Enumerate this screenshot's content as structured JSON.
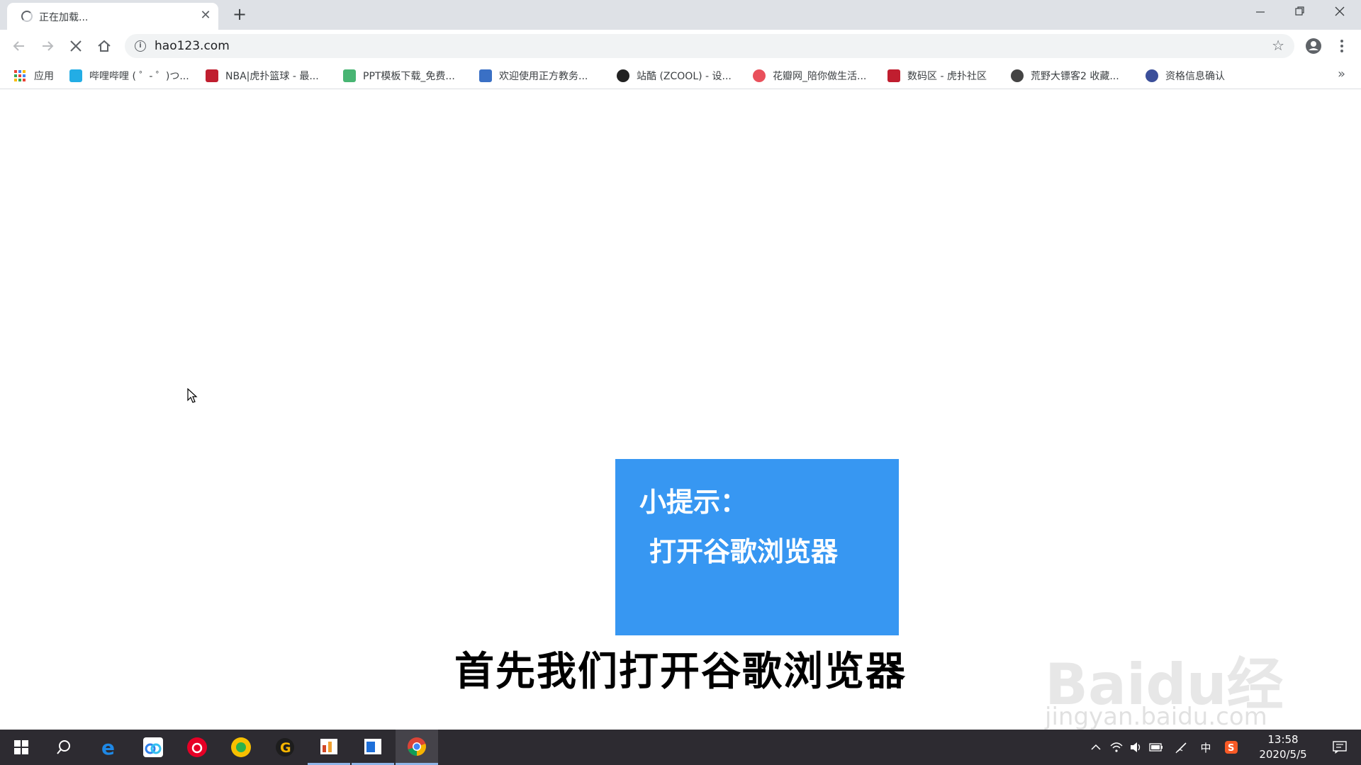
{
  "tab": {
    "title": "正在加载..."
  },
  "window_controls": {
    "minimize": "—",
    "restore": "❐",
    "close": "✕"
  },
  "toolbar": {
    "url": "hao123.com"
  },
  "bookmarks": [
    {
      "label": "应用",
      "icon": "apps-grid-icon"
    },
    {
      "label": "哔哩哔哩 ( ゜- ゜)つ...",
      "icon": "bilibili-icon",
      "color": "#23ade5"
    },
    {
      "label": "NBA|虎扑篮球 - 最...",
      "icon": "hupu-icon",
      "color": "#c01e2f"
    },
    {
      "label": "PPT模板下载_免费...",
      "icon": "ppt-template-icon",
      "color": "#48b573"
    },
    {
      "label": "欢迎使用正方教务...",
      "icon": "zhengfang-icon",
      "color": "#3a70c5"
    },
    {
      "label": "站酷 (ZCOOL) - 设...",
      "icon": "zcool-icon",
      "color": "#222222"
    },
    {
      "label": "花瓣网_陪你做生活...",
      "icon": "huaban-icon",
      "color": "#e9505b"
    },
    {
      "label": "数码区 - 虎扑社区",
      "icon": "hupu-icon",
      "color": "#c01e2f"
    },
    {
      "label": "荒野大镖客2 收藏...",
      "icon": "rdr2-icon",
      "color": "#444444"
    },
    {
      "label": "资格信息确认",
      "icon": "seal-icon",
      "color": "#3b4f9a"
    }
  ],
  "bookmarks_more": "»",
  "tip": {
    "title": "小提示：",
    "text": "打开谷歌浏览器"
  },
  "subtitle": "首先我们打开谷歌浏览器",
  "watermark": {
    "text": "Baidu经验",
    "sub": "jingyan.baidu.com"
  },
  "taskbar": {
    "apps": [
      "windows-start-icon",
      "search-icon",
      "edge-icon",
      "baidu-netdisk-icon",
      "netease-music-icon",
      "qq-browser-icon",
      "g-app-icon",
      "office-icon",
      "document-icon",
      "chrome-icon"
    ],
    "tray_ime": "中",
    "time": "13:58",
    "date": "2020/5/5"
  },
  "colors": {
    "tip_bg": "#3797f2",
    "taskbar_bg": "#2d2b31",
    "tabstrip_bg": "#dee1e6"
  }
}
